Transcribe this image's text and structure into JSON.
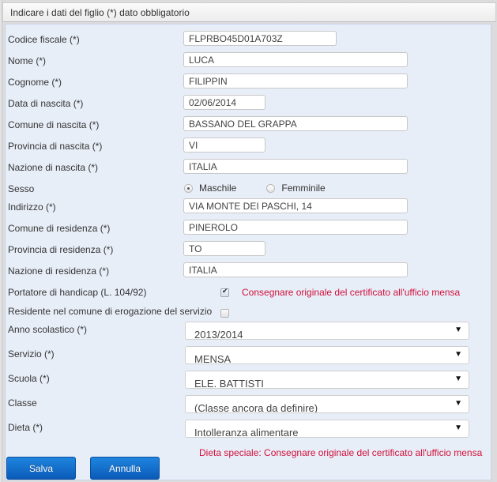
{
  "header": {
    "title": "Indicare i dati del figlio (*) dato obbligatorio"
  },
  "fields": {
    "codice_fiscale": {
      "label": "Codice fiscale (*)",
      "value": "FLPRBO45D01A703Z"
    },
    "nome": {
      "label": "Nome (*)",
      "value": "LUCA"
    },
    "cognome": {
      "label": "Cognome (*)",
      "value": "FILIPPIN"
    },
    "data_nascita": {
      "label": "Data di nascita (*)",
      "value": "02/06/2014"
    },
    "comune_nascita": {
      "label": "Comune di nascita (*)",
      "value": "BASSANO DEL GRAPPA"
    },
    "provincia_nascita": {
      "label": "Provincia di nascita (*)",
      "value": "VI"
    },
    "nazione_nascita": {
      "label": "Nazione di nascita (*)",
      "value": "ITALIA"
    },
    "sesso": {
      "label": "Sesso",
      "options": [
        {
          "label": "Maschile",
          "checked": true
        },
        {
          "label": "Femminile",
          "checked": false
        }
      ]
    },
    "indirizzo": {
      "label": "Indirizzo (*)",
      "value": "VIA MONTE DEI PASCHI, 14"
    },
    "comune_residenza": {
      "label": "Comune di residenza (*)",
      "value": "PINEROLO"
    },
    "provincia_residenza": {
      "label": "Provincia di residenza (*)",
      "value": "TO"
    },
    "nazione_residenza": {
      "label": "Nazione di residenza (*)",
      "value": "ITALIA"
    },
    "handicap": {
      "label": "Portatore di handicap (L. 104/92)",
      "checked": true,
      "notice": "Consegnare originale del certificato all'ufficio mensa"
    },
    "residente": {
      "label": "Residente nel comune di erogazione del servizio",
      "checked": false
    },
    "anno_scolastico": {
      "label": "Anno scolastico (*)",
      "value": "2013/2014"
    },
    "servizio": {
      "label": "Servizio (*)",
      "value": "MENSA"
    },
    "scuola": {
      "label": "Scuola (*)",
      "value": "ELE. BATTISTI"
    },
    "classe": {
      "label": "Classe",
      "value": "(Classe ancora da definire)"
    },
    "dieta": {
      "label": "Dieta (*)",
      "value": "Intolleranza alimentare",
      "notice": "Dieta speciale: Consegnare originale del certificato all'ufficio mensa"
    }
  },
  "buttons": {
    "save": "Salva",
    "cancel": "Annulla"
  },
  "colors": {
    "notice": "#d0103a",
    "button": "#1172cf",
    "panel": "#e8eef8"
  }
}
